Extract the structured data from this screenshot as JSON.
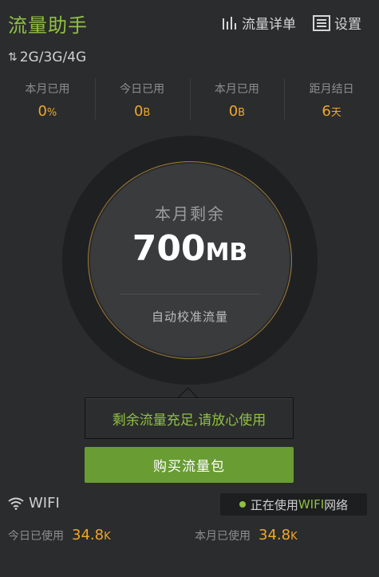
{
  "header": {
    "title": "流量助手",
    "detail_label": "流量详单",
    "settings_label": "设置"
  },
  "network": {
    "arrows": "⇅",
    "label": "2G/3G/4G"
  },
  "stats": [
    {
      "label": "本月已用",
      "value": "0",
      "unit": "%"
    },
    {
      "label": "今日已用",
      "value": "0",
      "unit": "B"
    },
    {
      "label": "本月已用",
      "value": "0",
      "unit": "B"
    },
    {
      "label": "距月结日",
      "value": "6",
      "unit": "天"
    }
  ],
  "gauge": {
    "label": "本月剩余",
    "value": "700",
    "unit": "MB",
    "calibrate_label": "自动校准流量"
  },
  "tip": {
    "text": "剩余流量充足,请放心使用"
  },
  "buy_button": {
    "label": "购买流量包"
  },
  "wifi": {
    "title": "WIFI",
    "badge_prefix": "正在使用",
    "badge_highlight": "WIFI",
    "badge_suffix": "网络",
    "today_label": "今日已使用",
    "today_value": "34.8",
    "today_unit": "K",
    "month_label": "本月已使用",
    "month_value": "34.8",
    "month_unit": "K"
  },
  "colors": {
    "brand_green": "#8fc043",
    "accent_orange": "#f0a72a",
    "button_green": "#699c33",
    "background": "#2b2c2d"
  },
  "icons": {
    "detail": "bar-chart-icon",
    "settings": "list-settings-icon",
    "wifi": "wifi-icon"
  }
}
